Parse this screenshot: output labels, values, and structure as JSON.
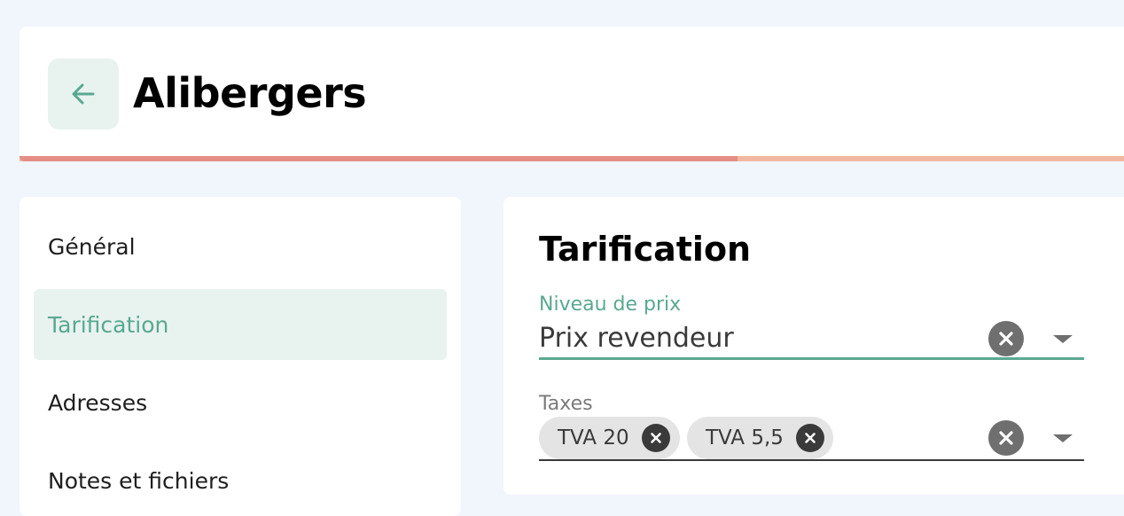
{
  "header": {
    "title": "Alibergers",
    "back_icon": "arrow-left-icon",
    "progress_fraction": 0.65,
    "colors": {
      "accent": "#5aa890",
      "progress": "#e48e86",
      "progress_track": "#f2b7a0"
    }
  },
  "sidebar": {
    "items": [
      {
        "label": "Général",
        "active": false
      },
      {
        "label": "Tarification",
        "active": true
      },
      {
        "label": "Adresses",
        "active": false
      },
      {
        "label": "Notes et fichiers",
        "active": false
      }
    ]
  },
  "panel": {
    "title": "Tarification",
    "price_level": {
      "label": "Niveau de prix",
      "value": "Prix revendeur",
      "clear_icon": "close-circle-icon",
      "dropdown_icon": "caret-down-icon"
    },
    "taxes": {
      "label": "Taxes",
      "chips": [
        {
          "label": "TVA 20"
        },
        {
          "label": "TVA 5,5"
        }
      ],
      "clear_icon": "close-circle-icon",
      "dropdown_icon": "caret-down-icon"
    }
  }
}
